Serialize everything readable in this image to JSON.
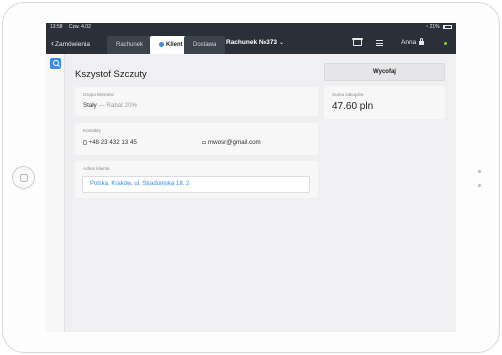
{
  "status_bar": {
    "time": "13:58",
    "date": "Czw. 4.02",
    "battery": "21%",
    "battery_level": 0.21
  },
  "nav": {
    "back_label": "Zamówienia",
    "tabs": [
      {
        "label": "Rachunek",
        "active": false
      },
      {
        "label": "Klient",
        "active": true
      },
      {
        "label": "Dostawa",
        "active": false
      }
    ],
    "receipt_title": "Rachunek №373",
    "user_name": "Anna",
    "online_color": "#7ed321"
  },
  "customer": {
    "name": "Kszystof Szczuty",
    "group": {
      "label": "Grupa klientów",
      "value": "Stały",
      "separator": "—",
      "discount": "Rabat 20%"
    },
    "contacts": {
      "label": "Kontakty",
      "phone": "+48 23 432 13 45",
      "email": "mwosr@gmail.com"
    },
    "address": {
      "label": "Adres klienta",
      "value": "Polska, Kraków, ul. Stradomska 18, 2"
    }
  },
  "summary": {
    "withdraw_label": "Wycofaj",
    "total_label": "Suma zakupów",
    "total_value": "47.60 pln"
  },
  "colors": {
    "accent": "#3b8be0",
    "navbar": "#2b2f37"
  }
}
